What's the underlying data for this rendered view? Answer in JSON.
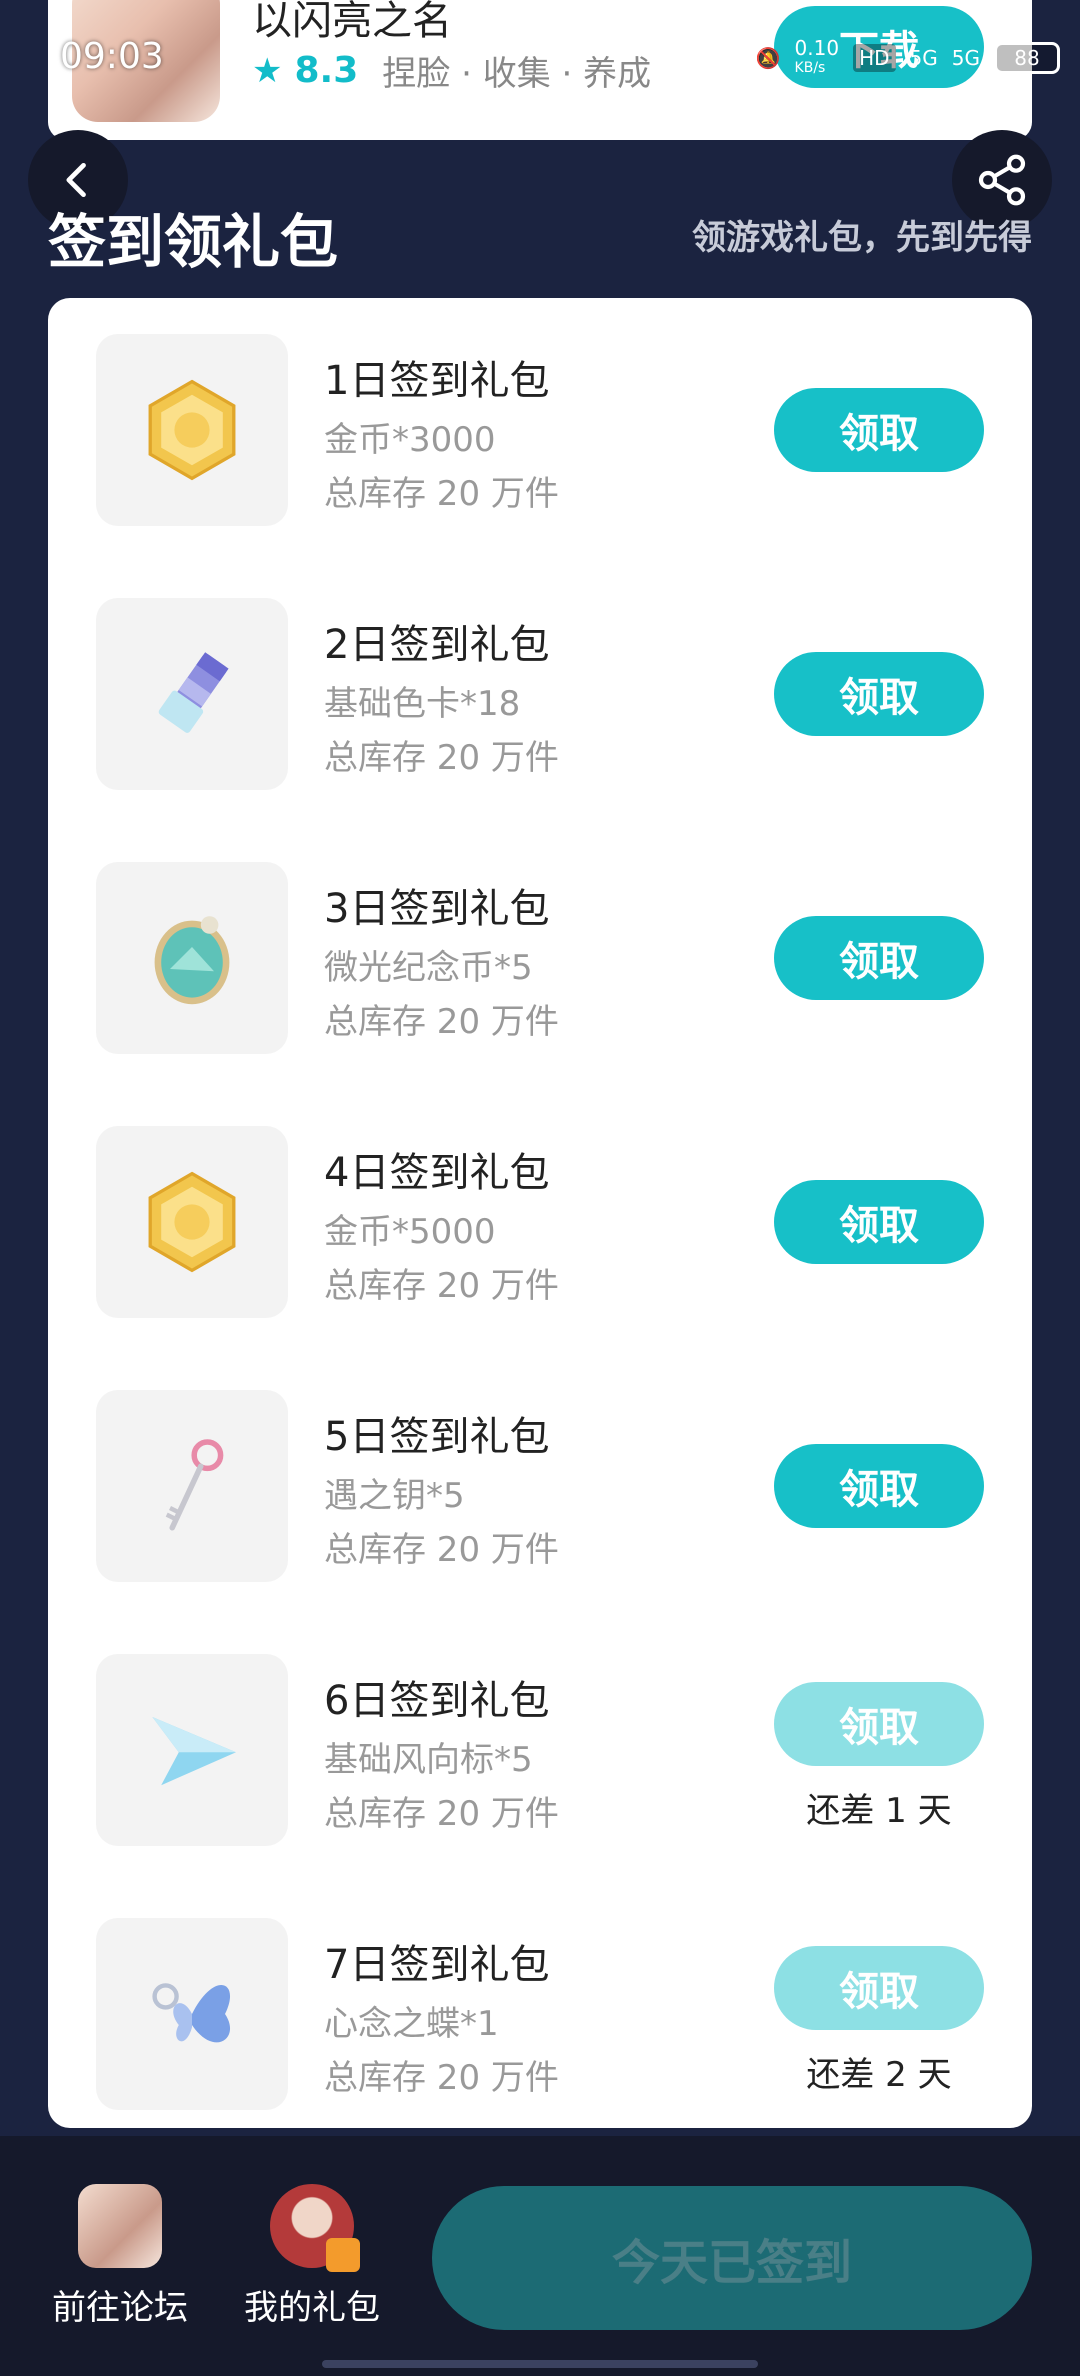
{
  "game": {
    "title": "以闪亮之名",
    "rating": "8.3",
    "tags": "捏脸 · 收集 · 养成",
    "download_label": "下载"
  },
  "status": {
    "time": "09:03",
    "net_speed_top": "0.10",
    "net_speed_bottom": "KB/s",
    "hd": "HD",
    "sig1": "5G",
    "sig2": "5G",
    "battery": "88"
  },
  "section": {
    "title": "签到领礼包",
    "subtitle": "领游戏礼包，先到先得"
  },
  "gifts": [
    {
      "name": "1日签到礼包",
      "content": "金币*3000",
      "stock": "总库存 20 万件",
      "button": "领取",
      "remain": ""
    },
    {
      "name": "2日签到礼包",
      "content": "基础色卡*18",
      "stock": "总库存 20 万件",
      "button": "领取",
      "remain": ""
    },
    {
      "name": "3日签到礼包",
      "content": "微光纪念币*5",
      "stock": "总库存 20 万件",
      "button": "领取",
      "remain": ""
    },
    {
      "name": "4日签到礼包",
      "content": "金币*5000",
      "stock": "总库存 20 万件",
      "button": "领取",
      "remain": ""
    },
    {
      "name": "5日签到礼包",
      "content": "遇之钥*5",
      "stock": "总库存 20 万件",
      "button": "领取",
      "remain": ""
    },
    {
      "name": "6日签到礼包",
      "content": "基础风向标*5",
      "stock": "总库存 20 万件",
      "button": "领取",
      "remain": "还差 1 天"
    },
    {
      "name": "7日签到礼包",
      "content": "心念之蝶*1",
      "stock": "总库存 20 万件",
      "button": "领取",
      "remain": "还差 2 天"
    }
  ],
  "bottom": {
    "forum_label": "前往论坛",
    "gifts_label": "我的礼包",
    "signed_label": "今天已签到"
  },
  "colors": {
    "accent": "#17c0c8",
    "accent_disabled": "#8de0e4",
    "background": "#1b2340"
  }
}
